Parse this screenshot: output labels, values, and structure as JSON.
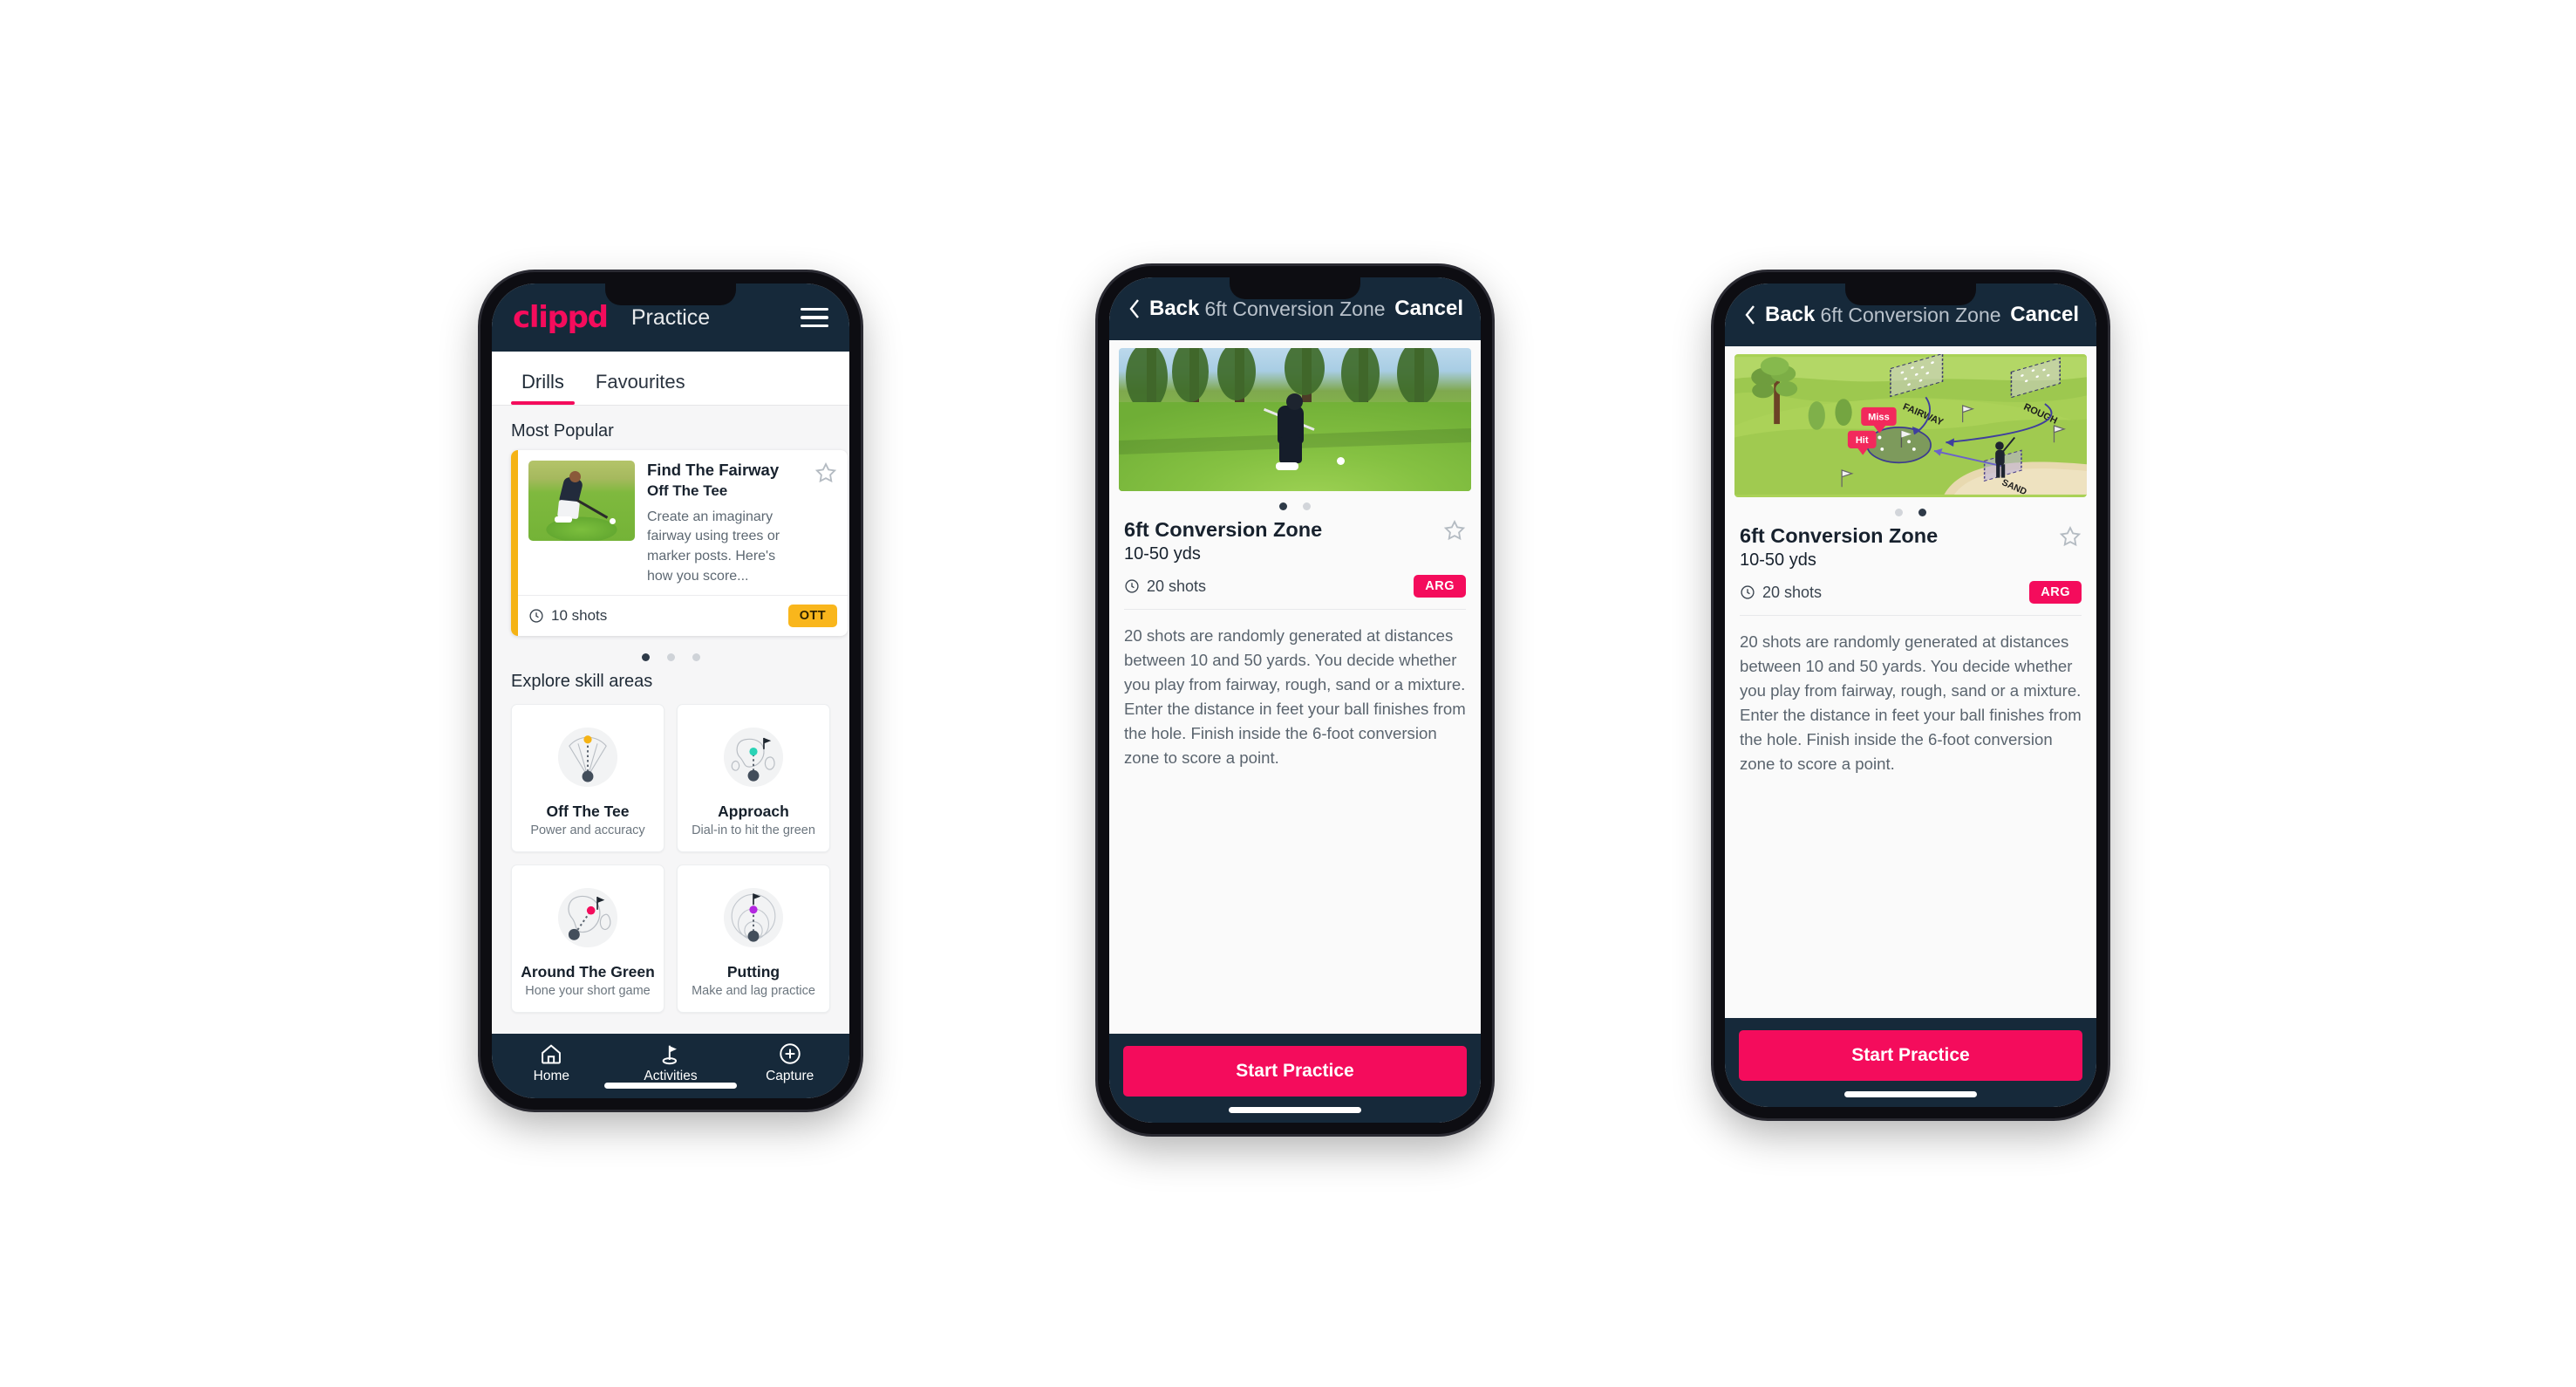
{
  "phone1": {
    "appbar": {
      "logo": "clippd",
      "title": "Practice",
      "menu_icon": "hamburger-icon"
    },
    "tabs": [
      {
        "label": "Drills",
        "active": true
      },
      {
        "label": "Favourites",
        "active": false
      }
    ],
    "sections": {
      "most_popular": "Most Popular",
      "explore": "Explore skill areas"
    },
    "drill_card": {
      "title": "Find The Fairway",
      "subtitle": "Off The Tee",
      "description": "Create an imaginary fairway using trees or marker posts. Here's how you score...",
      "shots": "10 shots",
      "badge": "OTT",
      "badge_color": "#f9b61c",
      "accent_color": "#f5b315",
      "star_icon": "star-outline-icon",
      "clock_icon": "clock-icon"
    },
    "carousel_dots": [
      true,
      false,
      false
    ],
    "skills": [
      {
        "name": "Off The Tee",
        "desc": "Power and accuracy",
        "icon": "tee-fan-icon",
        "accent": "#f5b315"
      },
      {
        "name": "Approach",
        "desc": "Dial-in to hit the green",
        "icon": "approach-green-icon",
        "accent": "#2ad3b6"
      },
      {
        "name": "Around The Green",
        "desc": "Hone your short game",
        "icon": "chip-green-icon",
        "accent": "#f40c5c"
      },
      {
        "name": "Putting",
        "desc": "Make and lag practice",
        "icon": "putting-rings-icon",
        "accent": "#b327e0"
      }
    ],
    "bottomnav": [
      {
        "label": "Home",
        "icon": "home-icon"
      },
      {
        "label": "Activities",
        "icon": "golf-flag-icon"
      },
      {
        "label": "Capture",
        "icon": "plus-circle-icon"
      }
    ]
  },
  "phone2": {
    "navbar": {
      "back": "Back",
      "title": "6ft Conversion Zone",
      "cancel": "Cancel",
      "back_icon": "chevron-left-icon"
    },
    "hero": "golf-photo-chipping",
    "dots": [
      true,
      false
    ],
    "detail": {
      "title": "6ft Conversion Zone",
      "subtitle": "10-50 yds",
      "shots": "20 shots",
      "badge": "ARG",
      "badge_color": "#f40c5c",
      "star_icon": "star-outline-icon",
      "clock_icon": "clock-icon",
      "description": "20 shots are randomly generated at distances between 10 and 50 yards. You decide whether you play from fairway, rough, sand or a mixture. Enter the distance in feet your ball finishes from the hole. Finish inside the 6-foot conversion zone to score a point."
    },
    "cta": "Start Practice"
  },
  "phone3": {
    "navbar": {
      "back": "Back",
      "title": "6ft Conversion Zone",
      "cancel": "Cancel",
      "back_icon": "chevron-left-icon"
    },
    "hero": "golf-course-illustration",
    "hero_labels": {
      "fairway": "FAIRWAY",
      "rough": "ROUGH",
      "sand": "SAND",
      "miss": "Miss",
      "hit": "Hit"
    },
    "dots": [
      false,
      true
    ],
    "detail": {
      "title": "6ft Conversion Zone",
      "subtitle": "10-50 yds",
      "shots": "20 shots",
      "badge": "ARG",
      "badge_color": "#f40c5c",
      "star_icon": "star-outline-icon",
      "clock_icon": "clock-icon",
      "description": "20 shots are randomly generated at distances between 10 and 50 yards. You decide whether you play from fairway, rough, sand or a mixture. Enter the distance in feet your ball finishes from the hole. Finish inside the 6-foot conversion zone to score a point."
    },
    "cta": "Start Practice"
  }
}
